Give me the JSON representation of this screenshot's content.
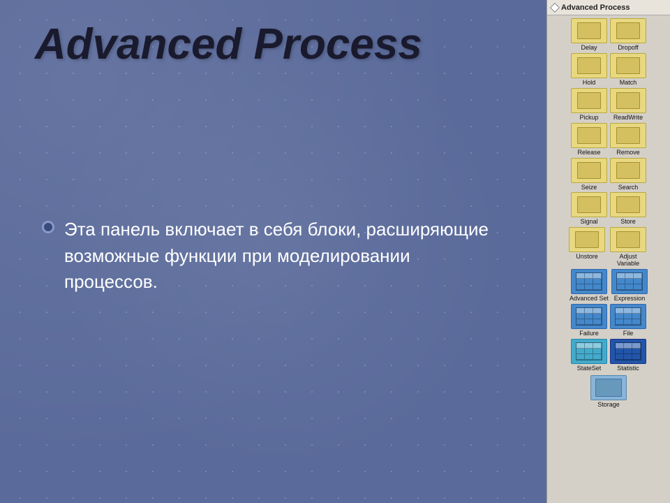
{
  "title": "Advanced Process",
  "subtitle": "Эта панель включает в себя блоки, расширяющие возможные функции при моделировании процессов.",
  "panel": {
    "title": "Advanced Process",
    "blocks": [
      {
        "row": [
          {
            "label": "Delay",
            "type": "yellow"
          },
          {
            "label": "Dropoff",
            "type": "yellow"
          }
        ]
      },
      {
        "row": [
          {
            "label": "Hold",
            "type": "yellow"
          },
          {
            "label": "Match",
            "type": "yellow"
          }
        ]
      },
      {
        "row": [
          {
            "label": "Pickup",
            "type": "yellow"
          },
          {
            "label": "ReadWrite",
            "type": "yellow"
          }
        ]
      },
      {
        "row": [
          {
            "label": "Release",
            "type": "yellow"
          },
          {
            "label": "Remove",
            "type": "yellow"
          }
        ]
      },
      {
        "row": [
          {
            "label": "Seize",
            "type": "yellow"
          },
          {
            "label": "Search",
            "type": "yellow"
          }
        ]
      },
      {
        "row": [
          {
            "label": "Signal",
            "type": "yellow"
          },
          {
            "label": "Store",
            "type": "yellow"
          }
        ]
      },
      {
        "row": [
          {
            "label": "Unstore",
            "type": "yellow"
          },
          {
            "label": "Adjust Variable",
            "type": "yellow"
          }
        ]
      },
      {
        "row": [
          {
            "label": "Advanced Set",
            "type": "table-blue"
          },
          {
            "label": "Expression",
            "type": "table-blue"
          }
        ]
      },
      {
        "row": [
          {
            "label": "Failure",
            "type": "table-blue"
          },
          {
            "label": "File",
            "type": "table-blue"
          }
        ]
      },
      {
        "row": [
          {
            "label": "StateSet",
            "type": "table-teal"
          },
          {
            "label": "Statistic",
            "type": "table-dark"
          }
        ]
      },
      {
        "row": [
          {
            "label": "Storage",
            "type": "storage"
          }
        ]
      }
    ]
  }
}
